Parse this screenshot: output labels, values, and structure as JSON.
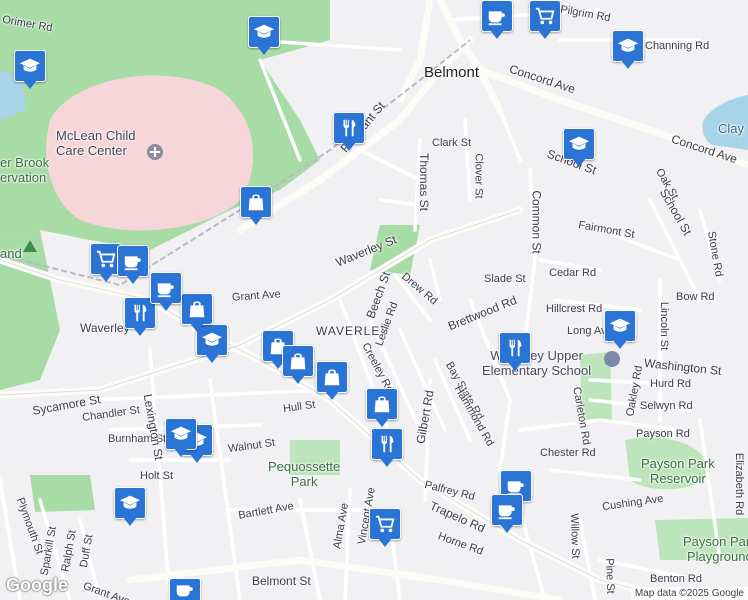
{
  "map": {
    "colors": {
      "background": "#f1f0f3",
      "road": "#ffffff",
      "major_road": "#fdfcf7",
      "park": "#a8dca6",
      "hospital": "#f7d6d9",
      "water": "#a8d4ea",
      "marker": "#2a74d6"
    },
    "place_labels": [
      {
        "text": "Belmont",
        "size": "l"
      },
      {
        "text": "Waverley",
        "size": "m"
      },
      {
        "text": "WAVERLEY",
        "size": "m"
      }
    ],
    "street_labels": [
      "Concord Ave",
      "Concord Ave",
      "Channing Rd",
      "Clark St",
      "Thomas St",
      "Clover St",
      "School St",
      "School St",
      "Common St",
      "Fairmont St",
      "Waverley St",
      "Drew Rd",
      "Slade St",
      "Cedar Rd",
      "Brettwood Rd",
      "Hillcrest Rd",
      "Long Ave",
      "Washington St",
      "Hurd Rd",
      "Selwyn Rd",
      "Bow Rd",
      "Oak St",
      "Stone Rd",
      "Lincoln St",
      "Oakley Rd",
      "Carleton Rd",
      "Payson Rd",
      "Chester Rd",
      "Cushing Ave",
      "Elizabeth Rd",
      "Grant Ave",
      "Beech St",
      "Leslie Rd",
      "Creeley Rd",
      "Bay State Rd",
      "Hammond Rd",
      "Gilbert Rd",
      "Sycamore St",
      "Chandler St",
      "Hull St",
      "Burnham St",
      "Walnut St",
      "Holt St",
      "Lexington St",
      "Palfrey Rd",
      "Trapelo Rd",
      "Horne Rd",
      "Bartlett Ave",
      "Alma Ave",
      "Vincent Ave",
      "Belmont St",
      "Pleasant St",
      "Willow St",
      "Pine St",
      "Benton Rd",
      "Plymouth St",
      "Sparkill St",
      "Ralph St",
      "Duff St",
      "Grant Ave",
      "Orimer Rd",
      "Pilgrim Rd"
    ],
    "poi_labels": [
      {
        "text": "McLean Child\nCare Center",
        "kind": "poi"
      },
      {
        "text": "Pequossette\nPark",
        "kind": "park"
      },
      {
        "text": "Payson Park\nReservoir",
        "kind": "park"
      },
      {
        "text": "Payson Park\nPlayground",
        "kind": "park"
      },
      {
        "text": "Waverley Upper\nElementary School",
        "kind": "poi"
      },
      {
        "text": "Clay",
        "kind": "water"
      },
      {
        "text": "er Brook\nervation",
        "kind": "park"
      },
      {
        "text": "and",
        "kind": "park"
      }
    ],
    "markers": [
      {
        "type": "school",
        "name": "school-marker"
      },
      {
        "type": "school",
        "name": "school-marker"
      },
      {
        "type": "school",
        "name": "school-marker"
      },
      {
        "type": "school",
        "name": "school-marker"
      },
      {
        "type": "school",
        "name": "school-marker"
      },
      {
        "type": "school",
        "name": "school-marker"
      },
      {
        "type": "school",
        "name": "school-marker"
      },
      {
        "type": "restaurant",
        "name": "restaurant-marker"
      },
      {
        "type": "restaurant",
        "name": "restaurant-marker"
      },
      {
        "type": "restaurant",
        "name": "restaurant-marker"
      },
      {
        "type": "restaurant",
        "name": "restaurant-marker"
      },
      {
        "type": "shopping",
        "name": "shopping-marker"
      },
      {
        "type": "shopping",
        "name": "shopping-marker"
      },
      {
        "type": "shopping",
        "name": "shopping-marker"
      },
      {
        "type": "shopping",
        "name": "shopping-marker"
      },
      {
        "type": "shopping",
        "name": "shopping-marker"
      },
      {
        "type": "cart",
        "name": "grocery-marker"
      },
      {
        "type": "cart",
        "name": "grocery-marker"
      },
      {
        "type": "cart",
        "name": "grocery-marker"
      },
      {
        "type": "cafe",
        "name": "cafe-marker"
      },
      {
        "type": "cafe",
        "name": "cafe-marker"
      },
      {
        "type": "cafe",
        "name": "cafe-marker"
      },
      {
        "type": "cafe",
        "name": "cafe-marker"
      },
      {
        "type": "cafe",
        "name": "cafe-marker"
      },
      {
        "type": "school",
        "name": "school-marker"
      },
      {
        "type": "school",
        "name": "school-marker"
      },
      {
        "type": "shopping",
        "name": "shopping-marker"
      },
      {
        "type": "shopping",
        "name": "shopping-marker"
      }
    ],
    "logo": "Google",
    "attribution": "Map data ©2025 Google"
  }
}
